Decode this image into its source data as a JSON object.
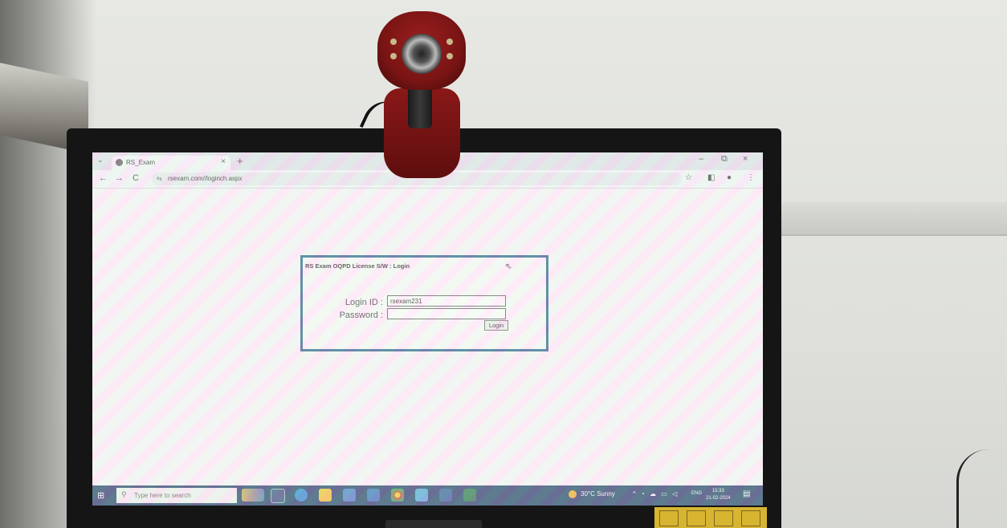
{
  "browser": {
    "tab_title": "RS_Exam",
    "tab_close": "×",
    "new_tab": "+",
    "tab_list": "⌄",
    "url": "rsexam.com//loginch.aspx",
    "back": "←",
    "forward": "→",
    "reload": "C",
    "minimize": "–",
    "restore": "⧉",
    "close": "×",
    "bookmark": "☆",
    "side_panel": "◧",
    "profile": "●",
    "menu": "⋮"
  },
  "login": {
    "title": "RS Exam OQPD License S/W : Login",
    "login_id_label": "Login ID :",
    "login_id_value": "rsexam231",
    "password_label": "Password :",
    "password_value": "",
    "login_button": "Login"
  },
  "taskbar": {
    "search_placeholder": "Type here to search",
    "weather": "30°C  Sunny",
    "language": "ENG",
    "time": "15:33",
    "date": "21-02-2024"
  },
  "colors": {
    "login_border": "#1f5e86",
    "taskbar": "#183a63",
    "webcam_red": "#8a1818"
  }
}
